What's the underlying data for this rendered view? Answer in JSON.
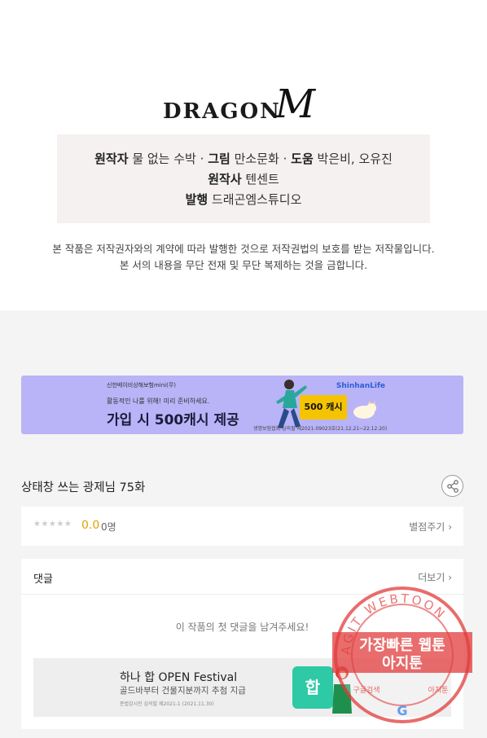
{
  "logo": {
    "word": "DRAGON",
    "mark": "M"
  },
  "credits": {
    "original_label": "원작자",
    "original_value": "물 없는 수박",
    "art_label": "그림",
    "art_value": "만소문화",
    "assist_label": "도움",
    "assist_value": "박은비, 오유진",
    "company_label": "원작사",
    "company_value": "텐센트",
    "publisher_label": "발행",
    "publisher_value": "드래곤엠스튜디오",
    "separator": "·"
  },
  "notice": {
    "line1": "본 작품은 저작권자와의 계약에 따라 발행한 것으로 저작권법의 보호를 받는 저작물입니다.",
    "line2": "본 서의 내용을 무단 전재 및 무단 복제하는 것을 금합니다."
  },
  "ad_banner": {
    "small": "신한베이비상해보험mini(무)",
    "desc": "활동적인 나를 위해! 미리 준비하세요.",
    "main": "가입 시 500캐시 제공",
    "brand": "ShinhanLife",
    "cash": "500 캐시",
    "fine": "생명보험협회 심의필 제2021-09023호(21.12.21~22.12.20)"
  },
  "episode": {
    "title": "상태창 쓰는 광제님 75화"
  },
  "rating": {
    "stars": "★★★★★",
    "score": "0.0",
    "count": "0명",
    "action": "별점주기"
  },
  "comments": {
    "title": "댓글",
    "more": "더보기",
    "empty": "이 작품의 첫 댓글을 남겨주세요!"
  },
  "ad2": {
    "title": "하나 합 OPEN Festival",
    "subtitle": "골드바부터 건물지분까지 추첨 지급",
    "fine": "준법감시인 심의필 제2021-1 (2021.11.30)",
    "logo": "합"
  },
  "watermark": {
    "ring_text": "AGIT WEBTOON",
    "line1": "가장빠른 웹툰",
    "line2": "아지툰",
    "small_left": "구글검색",
    "small_right": "아지툰",
    "g": "G"
  },
  "chevron": "›",
  "colors": {
    "credit_bg": "#f4f1f0",
    "page_bg": "#f4f4f4",
    "ad_bg": "#b9b3f7",
    "score": "#e2a300",
    "stamp": "#e23c3c"
  }
}
